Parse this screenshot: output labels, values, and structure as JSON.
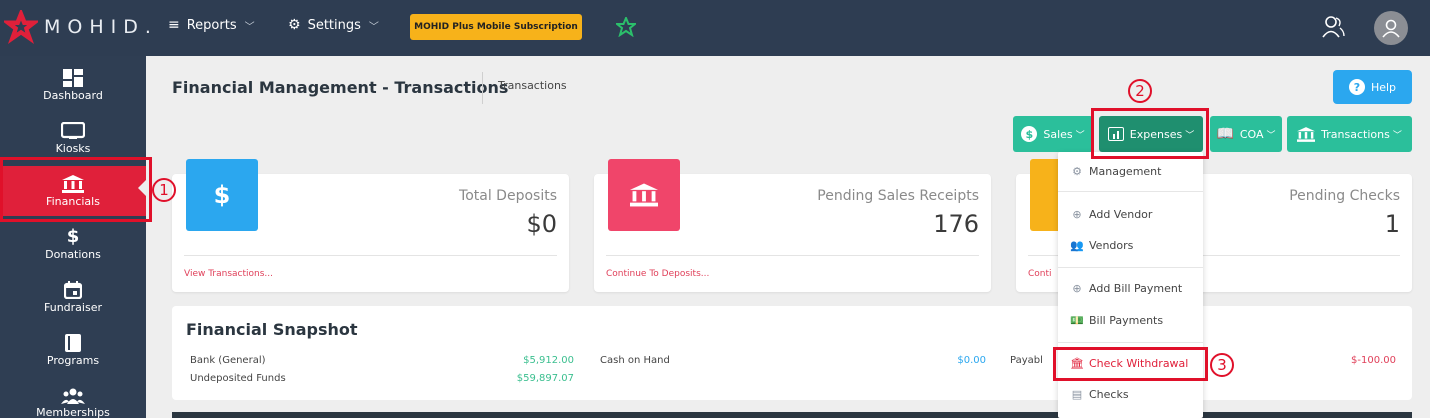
{
  "app": {
    "logo_text": "MOHID."
  },
  "topnav": {
    "reports": "Reports",
    "settings": "Settings",
    "subscription": "MOHID Plus Mobile Subscription"
  },
  "sidebar": {
    "items": [
      {
        "label": "Dashboard",
        "icon": "dashboard-icon"
      },
      {
        "label": "Kiosks",
        "icon": "monitor-icon"
      },
      {
        "label": "Financials",
        "icon": "bank-icon",
        "active": true
      },
      {
        "label": "Donations",
        "icon": "dollar-icon"
      },
      {
        "label": "Fundraiser",
        "icon": "calendar-icon"
      },
      {
        "label": "Programs",
        "icon": "book-icon"
      },
      {
        "label": "Memberships",
        "icon": "users-icon"
      }
    ]
  },
  "header": {
    "title": "Financial Management - Transactions",
    "breadcrumb": "Transactions",
    "help": "Help"
  },
  "toolbar": {
    "sales": "Sales",
    "expenses": "Expenses",
    "coa": "COA",
    "transactions": "Transactions"
  },
  "cards": [
    {
      "label": "Total Deposits",
      "value": "$0",
      "link": "View Transactions...",
      "icon": "dollar-icon",
      "color": "#2ba7ef"
    },
    {
      "label": "Pending Sales Receipts",
      "value": "176",
      "link": "Continue To Deposits...",
      "icon": "bank-icon",
      "color": "#f0456a"
    },
    {
      "label": "Pending Checks",
      "value": "1",
      "link": "Conti",
      "icon": "check-icon",
      "color": "#f7b21a"
    }
  ],
  "snapshot": {
    "title": "Financial Snapshot",
    "bank_label": "Bank (General)",
    "bank_value": "$5,912.00",
    "undeposited_label": "Undeposited Funds",
    "undeposited_value": "$59,897.07",
    "cash_label": "Cash on Hand",
    "cash_value": "$0.00",
    "payable_label": "Payabl",
    "payable_value": "$-100.00"
  },
  "expenses_menu": {
    "items": [
      {
        "label": "Management",
        "icon": "gears-icon"
      },
      {
        "label": "Add Vendor",
        "icon": "plus-circle-icon"
      },
      {
        "label": "Vendors",
        "icon": "users-icon"
      },
      {
        "label": "Add Bill Payment",
        "icon": "plus-circle-icon"
      },
      {
        "label": "Bill Payments",
        "icon": "money-icon"
      },
      {
        "label": "Check Withdrawal",
        "icon": "bank-icon",
        "highlighted": true
      },
      {
        "label": "Checks",
        "icon": "card-icon"
      }
    ]
  },
  "annotations": [
    "1",
    "2",
    "3"
  ],
  "colors": {
    "topbar": "#2e3d52",
    "sidebar": "#2f3e53",
    "active": "#e0203a",
    "teal": "#2bbf9b",
    "teal_dark": "#1f8f6f",
    "accent_red": "#e0102a"
  }
}
